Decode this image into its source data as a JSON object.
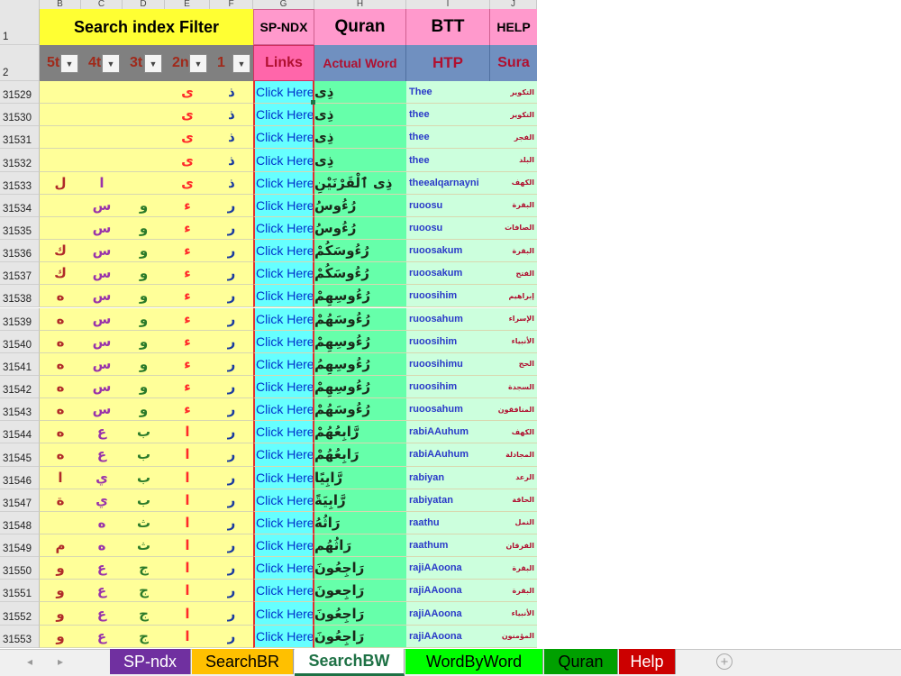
{
  "column_headers": [
    "B",
    "C",
    "D",
    "E",
    "F",
    "G",
    "H",
    "I",
    "J"
  ],
  "header_row_numbers": [
    "1",
    "2"
  ],
  "header": {
    "filter_title": "Search index Filter",
    "sp_ndx": "SP-NDX",
    "quran": "Quran",
    "btt": "BTT",
    "help": "HELP",
    "links": "Links",
    "actual_word": "Actual Word",
    "htp": "HTP",
    "sura": "Sura",
    "filter_labels": [
      "5t",
      "4t",
      "3t",
      "2n",
      "1"
    ]
  },
  "rows": [
    {
      "num": "31529",
      "c5": "",
      "c4": "",
      "c3": "",
      "c2": "ى",
      "c1": "ذ",
      "link": "Click Here",
      "word": "ذِى",
      "tr": "Thee",
      "sura": "التكوير"
    },
    {
      "num": "31530",
      "c5": "",
      "c4": "",
      "c3": "",
      "c2": "ى",
      "c1": "ذ",
      "link": "Click Here",
      "word": "ذِى",
      "tr": "thee",
      "sura": "التكوير"
    },
    {
      "num": "31531",
      "c5": "",
      "c4": "",
      "c3": "",
      "c2": "ى",
      "c1": "ذ",
      "link": "Click Here",
      "word": "ذِى",
      "tr": "thee",
      "sura": "الفجر"
    },
    {
      "num": "31532",
      "c5": "",
      "c4": "",
      "c3": "",
      "c2": "ى",
      "c1": "ذ",
      "link": "Click Here",
      "word": "ذِى",
      "tr": "thee",
      "sura": "البلد"
    },
    {
      "num": "31533",
      "c5": "ل",
      "c4": "ا",
      "c3": "",
      "c2": "ى",
      "c1": "ذ",
      "link": "Click Here",
      "word": "ذِى ٱلْقَرْنَيْنِ",
      "tr": "theealqarnayni",
      "sura": "الكهف"
    },
    {
      "num": "31534",
      "c5": "",
      "c4": "س",
      "c3": "و",
      "c2": "ء",
      "c1": "ر",
      "link": "Click Here",
      "word": "رُءُوسُ",
      "tr": "ruoosu",
      "sura": "البقرة"
    },
    {
      "num": "31535",
      "c5": "",
      "c4": "س",
      "c3": "و",
      "c2": "ء",
      "c1": "ر",
      "link": "Click Here",
      "word": "رُءُوسُ",
      "tr": "ruoosu",
      "sura": "الصافات"
    },
    {
      "num": "31536",
      "c5": "ك",
      "c4": "س",
      "c3": "و",
      "c2": "ء",
      "c1": "ر",
      "link": "Click Here",
      "word": "رُءُوسَكُمْ",
      "tr": "ruoosakum",
      "sura": "البقرة"
    },
    {
      "num": "31537",
      "c5": "ك",
      "c4": "س",
      "c3": "و",
      "c2": "ء",
      "c1": "ر",
      "link": "Click Here",
      "word": "رُءُوسَكُمْ",
      "tr": "ruoosakum",
      "sura": "الفتح"
    },
    {
      "num": "31538",
      "c5": "ه",
      "c4": "س",
      "c3": "و",
      "c2": "ء",
      "c1": "ر",
      "link": "Click Here",
      "word": "رُءُوسِهِمْ",
      "tr": "ruoosihim",
      "sura": "إبراهيم"
    },
    {
      "num": "31539",
      "c5": "ه",
      "c4": "س",
      "c3": "و",
      "c2": "ء",
      "c1": "ر",
      "link": "Click Here",
      "word": "رُءُوسَهُمْ",
      "tr": "ruoosahum",
      "sura": "الإسراء"
    },
    {
      "num": "31540",
      "c5": "ه",
      "c4": "س",
      "c3": "و",
      "c2": "ء",
      "c1": "ر",
      "link": "Click Here",
      "word": "رُءُوسِهِمْ",
      "tr": "ruoosihim",
      "sura": "الأنبياء"
    },
    {
      "num": "31541",
      "c5": "ه",
      "c4": "س",
      "c3": "و",
      "c2": "ء",
      "c1": "ر",
      "link": "Click Here",
      "word": "رُءُوسِهِمُ",
      "tr": "ruoosihimu",
      "sura": "الحج"
    },
    {
      "num": "31542",
      "c5": "ه",
      "c4": "س",
      "c3": "و",
      "c2": "ء",
      "c1": "ر",
      "link": "Click Here",
      "word": "رُءُوسِهِمْ",
      "tr": "ruoosihim",
      "sura": "السجدة"
    },
    {
      "num": "31543",
      "c5": "ه",
      "c4": "س",
      "c3": "و",
      "c2": "ء",
      "c1": "ر",
      "link": "Click Here",
      "word": "رُءُوسَهُمْ",
      "tr": "ruoosahum",
      "sura": "المنافقون"
    },
    {
      "num": "31544",
      "c5": "ه",
      "c4": "ع",
      "c3": "ب",
      "c2": "ا",
      "c1": "ر",
      "link": "Click Here",
      "word": "رَّابِعُهُمْ",
      "tr": "rabiAAuhum",
      "sura": "الكهف"
    },
    {
      "num": "31545",
      "c5": "ه",
      "c4": "ع",
      "c3": "ب",
      "c2": "ا",
      "c1": "ر",
      "link": "Click Here",
      "word": "رَابِعُهُمْ",
      "tr": "rabiAAuhum",
      "sura": "المجادلة"
    },
    {
      "num": "31546",
      "c5": "ا",
      "c4": "ي",
      "c3": "ب",
      "c2": "ا",
      "c1": "ر",
      "link": "Click Here",
      "word": "رَّابِيًا",
      "tr": "rabiyan",
      "sura": "الرعد"
    },
    {
      "num": "31547",
      "c5": "ة",
      "c4": "ي",
      "c3": "ب",
      "c2": "ا",
      "c1": "ر",
      "link": "Click Here",
      "word": "رَّابِيَةً",
      "tr": "rabiyatan",
      "sura": "الحاقة"
    },
    {
      "num": "31548",
      "c5": "",
      "c4": "ه",
      "c3": "ث",
      "c2": "ا",
      "c1": "ر",
      "link": "Click Here",
      "word": "رَاثُهُ",
      "tr": "raathu",
      "sura": "النمل"
    },
    {
      "num": "31549",
      "c5": "م",
      "c4": "ه",
      "c3": "ث",
      "c2": "ا",
      "c1": "ر",
      "link": "Click Here",
      "word": "رَاثُهُم",
      "tr": "raathum",
      "sura": "الفرقان"
    },
    {
      "num": "31550",
      "c5": "و",
      "c4": "ع",
      "c3": "ج",
      "c2": "ا",
      "c1": "ر",
      "link": "Click Here",
      "word": "رَاجِعُونَ",
      "tr": "rajiAAoona",
      "sura": "البقرة"
    },
    {
      "num": "31551",
      "c5": "و",
      "c4": "ع",
      "c3": "ج",
      "c2": "ا",
      "c1": "ر",
      "link": "Click Here",
      "word": "رَاجِعونَ",
      "tr": "rajiAAoona",
      "sura": "البقرة"
    },
    {
      "num": "31552",
      "c5": "و",
      "c4": "ع",
      "c3": "ج",
      "c2": "ا",
      "c1": "ر",
      "link": "Click Here",
      "word": "رَاجِعُونَ",
      "tr": "rajiAAoona",
      "sura": "الأنبياء"
    },
    {
      "num": "31553",
      "c5": "و",
      "c4": "ع",
      "c3": "ج",
      "c2": "ا",
      "c1": "ر",
      "link": "Click Here",
      "word": "رَاجِعُونَ",
      "tr": "rajiAAoona",
      "sura": "المؤمنون"
    }
  ],
  "sheet_tabs": [
    {
      "label": "SP-ndx",
      "bg": "#7030a0",
      "fg": "#ffffff"
    },
    {
      "label": "SearchBR",
      "bg": "#ffc000",
      "fg": "#000000"
    },
    {
      "label": "SearchBW",
      "bg": "#ffffff",
      "fg": "#1e7145",
      "active": true
    },
    {
      "label": "WordByWord",
      "bg": "#00ff00",
      "fg": "#000000"
    },
    {
      "label": "Quran",
      "bg": "#00a000",
      "fg": "#000000"
    },
    {
      "label": "Help",
      "bg": "#cc0000",
      "fg": "#ffffff"
    }
  ],
  "nav_icons": [
    "scroll-left-icon",
    "scroll-right-icon",
    "add-sheet-icon"
  ],
  "colors": {
    "yellow": "#ffff99",
    "cyan": "#66ffff",
    "green": "#66ffaa",
    "mint": "#ccffdd",
    "link_blue": "#0033cc",
    "red_letter": "#ff2a2a",
    "purple_letter": "#9933aa",
    "dark_red_letter": "#b02a2a"
  }
}
